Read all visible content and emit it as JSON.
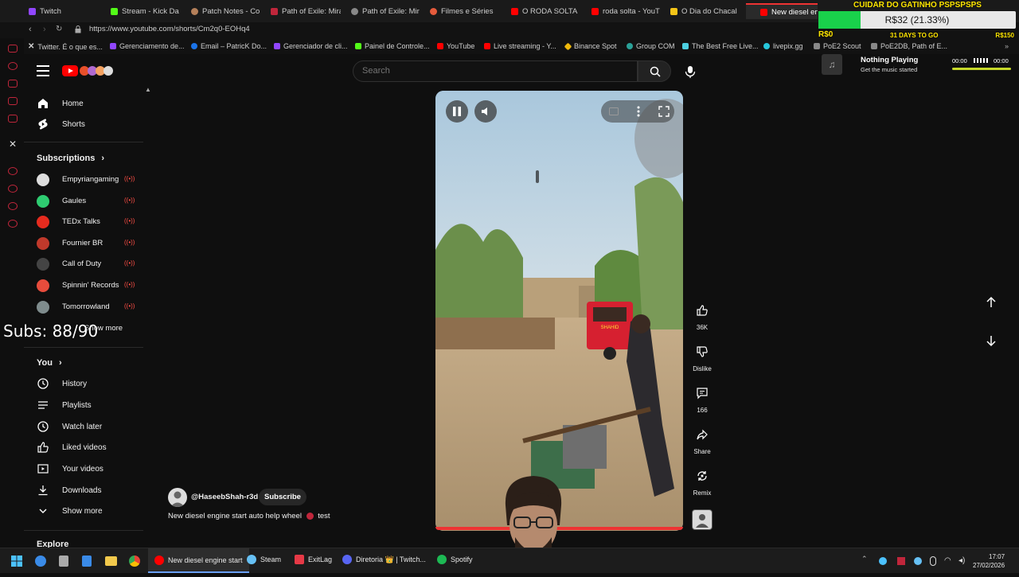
{
  "browser": {
    "tabs": [
      {
        "label": "Twitch",
        "color": "#9146ff"
      },
      {
        "label": "Stream - Kick Dashb",
        "color": "#53fc18"
      },
      {
        "label": "Patch Notes - Conv",
        "color": "#b5805a"
      },
      {
        "label": "Path of Exile: Mirag",
        "color": "#c0263b"
      },
      {
        "label": "Path of Exile: Mirag",
        "color": "#888888"
      },
      {
        "label": "Filmes e Séries",
        "color": "#e55b3c"
      },
      {
        "label": "O RODA SOLTA MA",
        "color": "#ff0000"
      },
      {
        "label": "roda solta - YouTub",
        "color": "#ff0000"
      },
      {
        "label": "O Dia do Chacal (S",
        "color": "#f5c518"
      },
      {
        "label": "New diesel engine st",
        "color": "#ff0000"
      }
    ],
    "url": "https://www.youtube.com/shorts/Cm2q0-EOHq4",
    "bookmarks": [
      {
        "label": "Twitter. É o que es...",
        "color": "#ffffff"
      },
      {
        "label": "Gerenciamento de...",
        "color": "#9146ff"
      },
      {
        "label": "Email – PatricK Do...",
        "color": "#1a73e8"
      },
      {
        "label": "Gerenciador de cli...",
        "color": "#9146ff"
      },
      {
        "label": "Painel de Controle...",
        "color": "#53fc18"
      },
      {
        "label": "YouTube",
        "color": "#ff0000"
      },
      {
        "label": "Live streaming - Y...",
        "color": "#ff0000"
      },
      {
        "label": "Binance Spot",
        "color": "#f0b90b"
      },
      {
        "label": "Group COM",
        "color": "#2aa198"
      },
      {
        "label": "The Best Free Live...",
        "color": "#4dd0e1"
      },
      {
        "label": "livepix.gg",
        "color": "#26c6da"
      },
      {
        "label": "PoE2 Scout",
        "color": "#888888"
      },
      {
        "label": "PoE2DB, Path of E...",
        "color": "#888888"
      }
    ]
  },
  "youtube": {
    "search_placeholder": "Search",
    "nav": {
      "home": "Home",
      "shorts": "Shorts"
    },
    "subscriptions_title": "Subscriptions",
    "subscriptions": [
      {
        "name": "Empyriangaming",
        "color": "#dddddd"
      },
      {
        "name": "Gaules",
        "color": "#2ecc71"
      },
      {
        "name": "TEDx Talks",
        "color": "#e62b1e"
      },
      {
        "name": "Fournier BR",
        "color": "#c0392b"
      },
      {
        "name": "Call of Duty",
        "color": "#222222"
      },
      {
        "name": "Spinnin' Records",
        "color": "#e74c3c"
      },
      {
        "name": "Tomorrowland",
        "color": "#7f8c8d"
      }
    ],
    "show_more_subs": "Show more",
    "live_icon": "((•))",
    "you_title": "You",
    "you_items": [
      "History",
      "Playlists",
      "Watch later",
      "Liked videos",
      "Your videos",
      "Downloads",
      "Show more"
    ],
    "explore_title": "Explore",
    "actions": {
      "likes": "36K",
      "dislike": "Dislike",
      "comments": "166",
      "share": "Share",
      "remix": "Remix"
    },
    "channel": "@HaseebShah-r3d",
    "subscribe": "Subscribe",
    "video_title": "New diesel engine start auto help wheel",
    "video_title_suffix": "test",
    "rickshaw_sign": "SHAHID"
  },
  "overlays": {
    "subs": "Subs: 88/90",
    "goal_title": "CUIDAR DO GATINHO PSPSPSPS",
    "goal_amount": "R$32 (21.33%)",
    "goal_progress": 0.2133,
    "goal_min": "R$0",
    "goal_max": "R$150",
    "goal_days": "31 DAYS TO GO",
    "nowplaying_title": "Nothing Playing",
    "nowplaying_sub": "Get the music started",
    "time_start": "00:00",
    "time_end": "00:00"
  },
  "taskbar": {
    "items": [
      {
        "label": "New diesel engine start",
        "color": "#ff0000"
      },
      {
        "label": "Steam",
        "color": "#66c0f4"
      },
      {
        "label": "ExitLag",
        "color": "#e63946"
      },
      {
        "label": "Diretoria 👑 | Twitch...",
        "color": "#5865f2"
      },
      {
        "label": "Spotify",
        "color": "#1db954"
      }
    ],
    "time": "17:07",
    "date": "27/02/2026"
  }
}
